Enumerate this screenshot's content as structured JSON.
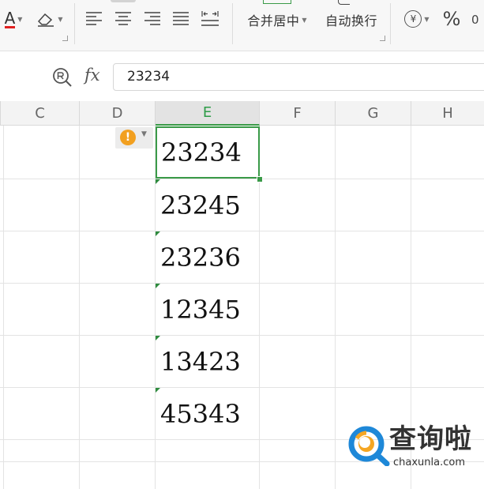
{
  "ribbon": {
    "font_color_label": "A",
    "merge_center_label": "合并居中",
    "wrap_text_label": "自动换行",
    "currency_symbol": "¥",
    "percent_symbol": "%",
    "accent_color": "#3a9a48"
  },
  "formula_bar": {
    "fx_label": "fx",
    "value": "23234"
  },
  "columns": [
    "C",
    "D",
    "E",
    "F",
    "G",
    "H"
  ],
  "active_column": "E",
  "cells": {
    "e1": "23234",
    "e2": "23245",
    "e3": "23236",
    "e4": "12345",
    "e5": "13423",
    "e6": "45343"
  },
  "warning": {
    "icon": "!"
  },
  "watermark": {
    "title": "查询啦",
    "url": "chaxunla.com"
  }
}
